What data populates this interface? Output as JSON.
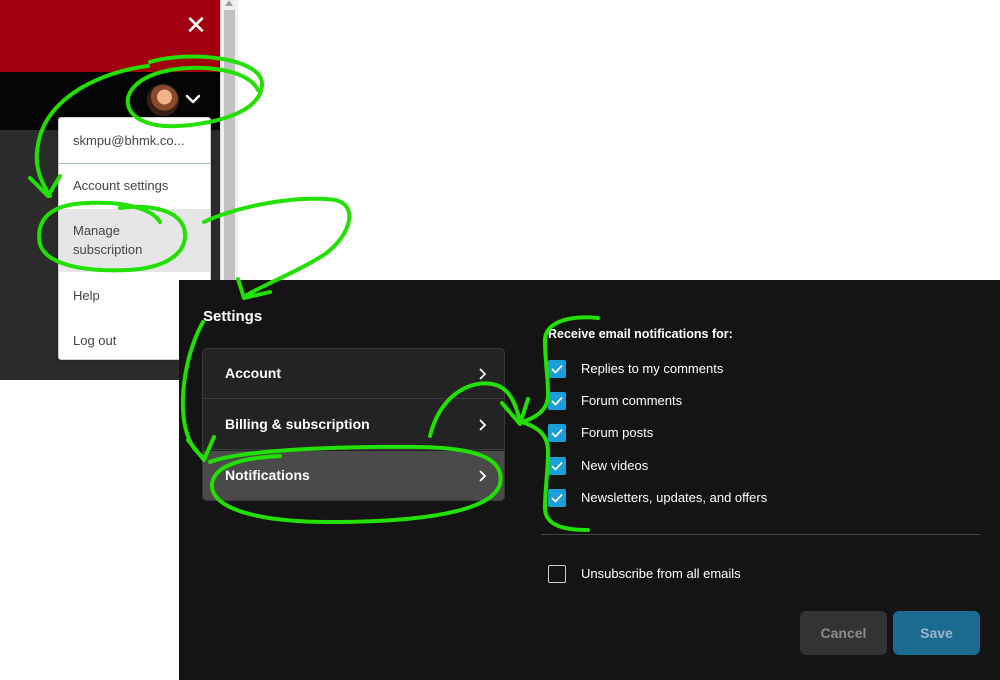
{
  "dropdown": {
    "email": "skmpu@bhmk.co...",
    "items": [
      {
        "label": "Account settings"
      },
      {
        "label": "Manage subscription"
      },
      {
        "label": "Help"
      },
      {
        "label": "Log out"
      }
    ]
  },
  "icons": {
    "close": "close-icon",
    "avatar": "avatar",
    "dropdown_toggle": "chevron-down-icon"
  },
  "settings": {
    "title": "Settings",
    "nav": [
      {
        "label": "Account",
        "selected": false
      },
      {
        "label": "Billing & subscription",
        "selected": false
      },
      {
        "label": "Notifications",
        "selected": true
      }
    ],
    "email_heading": "Receive email notifications for:",
    "options": [
      {
        "label": "Replies to my comments",
        "checked": true
      },
      {
        "label": "Forum comments",
        "checked": true
      },
      {
        "label": "Forum posts",
        "checked": true
      },
      {
        "label": "New videos",
        "checked": true
      },
      {
        "label": "Newsletters, updates, and offers",
        "checked": true
      }
    ],
    "unsubscribe": {
      "label": "Unsubscribe from all emails",
      "checked": false
    },
    "buttons": {
      "cancel": "Cancel",
      "save": "Save"
    }
  },
  "colors": {
    "header_red": "#a1000f",
    "checkbox_blue": "#1a9fd8",
    "save_button": "#1b6a90",
    "annotation_green": "#22e000"
  }
}
